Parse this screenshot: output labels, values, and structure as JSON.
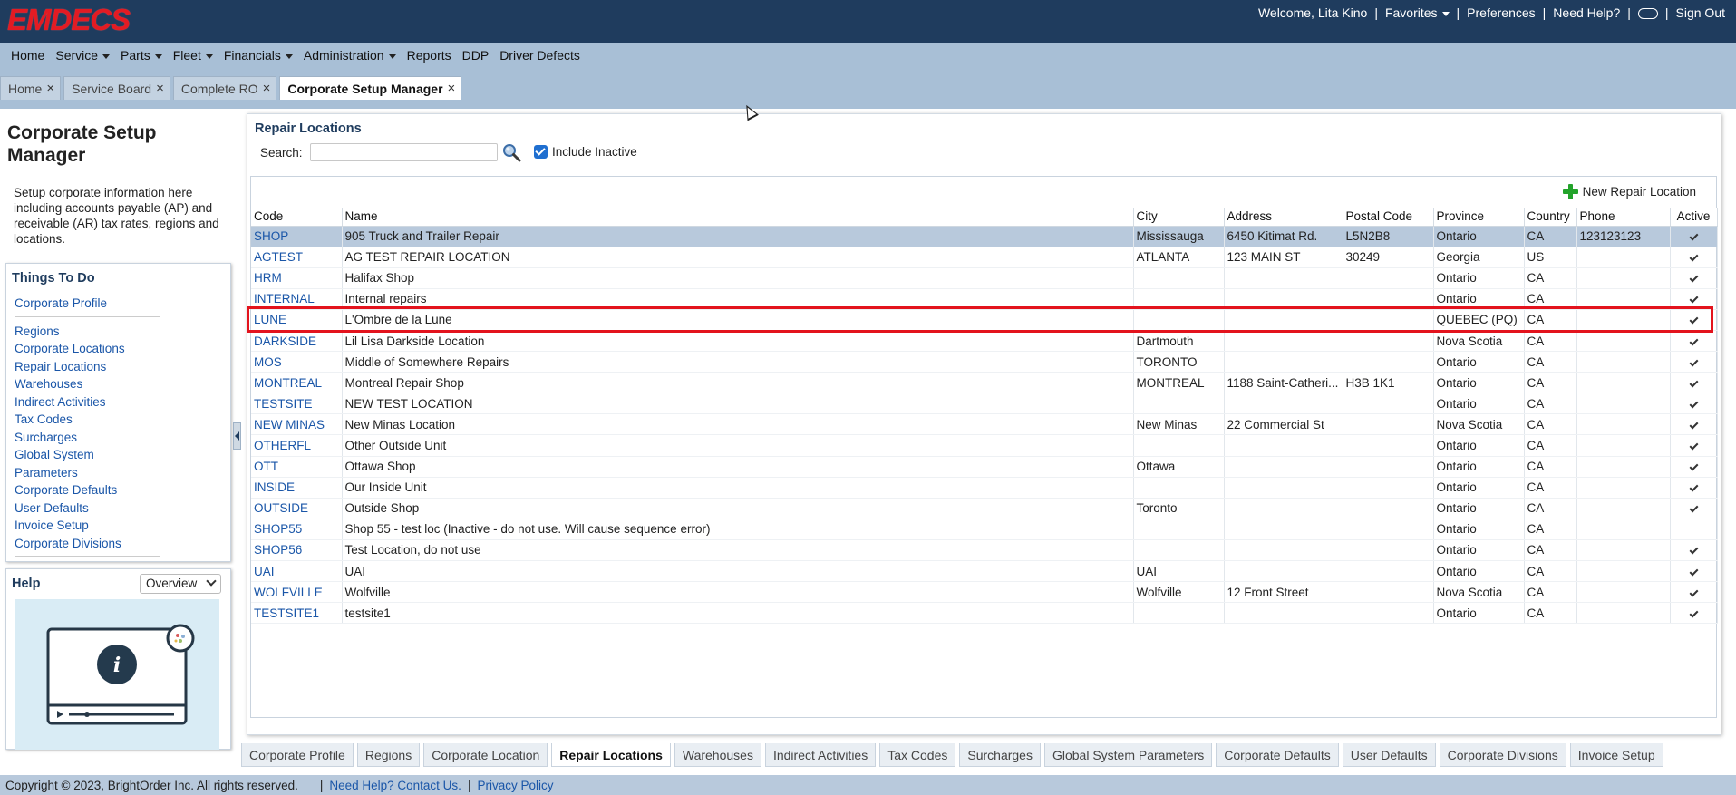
{
  "brand": {
    "logo_text": "EMDECS",
    "logo_color": "#e31b23"
  },
  "topnav": {
    "welcome": "Welcome, Lita Kino",
    "favorites": "Favorites",
    "preferences": "Preferences",
    "need_help": "Need Help?",
    "sign_out": "Sign Out",
    "chat_icon": "chat-bubble-icon",
    "separator": "|"
  },
  "mainmenu": {
    "home": "Home",
    "service": "Service",
    "parts": "Parts",
    "fleet": "Fleet",
    "financials": "Financials",
    "administration": "Administration",
    "reports": "Reports",
    "ddp": "DDP",
    "driver_defects": "Driver Defects"
  },
  "pagetabs": {
    "home": "Home",
    "service_board": "Service Board",
    "complete_ro": "Complete RO",
    "corporate_setup_manager": "Corporate Setup Manager",
    "close_glyph": "×"
  },
  "left": {
    "title": "Corporate Setup Manager",
    "description": "Setup corporate information here including accounts payable (AP) and receivable (AR) tax rates, regions and locations.",
    "todo_title": "Things To Do",
    "todo_first": "Corporate Profile",
    "todo_items": [
      "Regions",
      "Corporate Locations",
      "Repair Locations",
      "Warehouses",
      "Indirect Activities",
      "Tax Codes",
      "Surcharges",
      "Global System Parameters",
      "Corporate Defaults",
      "User Defaults",
      "Invoice Setup",
      "Corporate Divisions"
    ],
    "help_title": "Help",
    "help_select": "Overview"
  },
  "main": {
    "title": "Repair Locations",
    "search_label": "Search:",
    "search_value": "",
    "include_inactive_label": "Include Inactive",
    "include_inactive_checked": true,
    "new_button": "New Repair Location",
    "columns": {
      "code": "Code",
      "name": "Name",
      "city": "City",
      "address": "Address",
      "postal": "Postal Code",
      "province": "Province",
      "country": "Country",
      "phone": "Phone",
      "active": "Active"
    },
    "rows": [
      {
        "code": "SHOP",
        "name": "905 Truck and Trailer Repair",
        "city": "Mississauga",
        "address": "6450 Kitimat Rd.",
        "postal": "L5N2B8",
        "province": "Ontario",
        "country": "CA",
        "phone": "123123123",
        "active": true
      },
      {
        "code": "AGTEST",
        "name": "AG TEST REPAIR LOCATION",
        "city": "ATLANTA",
        "address": "123 MAIN ST",
        "postal": "30249",
        "province": "Georgia",
        "country": "US",
        "phone": "",
        "active": true
      },
      {
        "code": "HRM",
        "name": "Halifax Shop",
        "city": "",
        "address": "",
        "postal": "",
        "province": "Ontario",
        "country": "CA",
        "phone": "",
        "active": true
      },
      {
        "code": "INTERNAL",
        "name": "Internal repairs",
        "city": "",
        "address": "",
        "postal": "",
        "province": "Ontario",
        "country": "CA",
        "phone": "",
        "active": true
      },
      {
        "code": "LUNE",
        "name": "L'Ombre de la Lune",
        "city": "",
        "address": "",
        "postal": "",
        "province": "QUEBEC (PQ)",
        "country": "CA",
        "phone": "",
        "active": true
      },
      {
        "code": "DARKSIDE",
        "name": "Lil Lisa Darkside Location",
        "city": "Dartmouth",
        "address": "",
        "postal": "",
        "province": "Nova Scotia",
        "country": "CA",
        "phone": "",
        "active": true
      },
      {
        "code": "MOS",
        "name": "Middle of Somewhere Repairs",
        "city": "TORONTO",
        "address": "",
        "postal": "",
        "province": "Ontario",
        "country": "CA",
        "phone": "",
        "active": true
      },
      {
        "code": "MONTREAL",
        "name": "Montreal Repair Shop",
        "city": "MONTREAL",
        "address": "1188 Saint-Catheri...",
        "postal": "H3B 1K1",
        "province": "Ontario",
        "country": "CA",
        "phone": "",
        "active": true
      },
      {
        "code": "TESTSITE",
        "name": "NEW TEST LOCATION",
        "city": "",
        "address": "",
        "postal": "",
        "province": "Ontario",
        "country": "CA",
        "phone": "",
        "active": true
      },
      {
        "code": "NEW MINAS",
        "name": "New Minas Location",
        "city": "New Minas",
        "address": "22 Commercial St",
        "postal": "",
        "province": "Nova Scotia",
        "country": "CA",
        "phone": "",
        "active": true
      },
      {
        "code": "OTHERFL",
        "name": "Other Outside Unit",
        "city": "",
        "address": "",
        "postal": "",
        "province": "Ontario",
        "country": "CA",
        "phone": "",
        "active": true
      },
      {
        "code": "OTT",
        "name": "Ottawa Shop",
        "city": "Ottawa",
        "address": "",
        "postal": "",
        "province": "Ontario",
        "country": "CA",
        "phone": "",
        "active": true
      },
      {
        "code": "INSIDE",
        "name": "Our Inside Unit",
        "city": "",
        "address": "",
        "postal": "",
        "province": "Ontario",
        "country": "CA",
        "phone": "",
        "active": true
      },
      {
        "code": "OUTSIDE",
        "name": "Outside Shop",
        "city": "Toronto",
        "address": "",
        "postal": "",
        "province": "Ontario",
        "country": "CA",
        "phone": "",
        "active": true
      },
      {
        "code": "SHOP55",
        "name": "Shop 55 - test loc (Inactive - do not use. Will cause sequence error)",
        "city": "",
        "address": "",
        "postal": "",
        "province": "Ontario",
        "country": "CA",
        "phone": "",
        "active": false
      },
      {
        "code": "SHOP56",
        "name": "Test Location, do not use",
        "city": "",
        "address": "",
        "postal": "",
        "province": "Ontario",
        "country": "CA",
        "phone": "",
        "active": true
      },
      {
        "code": "UAI",
        "name": "UAI",
        "city": "UAI",
        "address": "",
        "postal": "",
        "province": "Ontario",
        "country": "CA",
        "phone": "",
        "active": true
      },
      {
        "code": "WOLFVILLE",
        "name": "Wolfville",
        "city": "Wolfville",
        "address": "12 Front Street",
        "postal": "",
        "province": "Nova Scotia",
        "country": "CA",
        "phone": "",
        "active": true
      },
      {
        "code": "TESTSITE1",
        "name": "testsite1",
        "city": "",
        "address": "",
        "postal": "",
        "province": "Ontario",
        "country": "CA",
        "phone": "",
        "active": true
      }
    ]
  },
  "bottom_tabs": [
    "Corporate Profile",
    "Regions",
    "Corporate Location",
    "Repair Locations",
    "Warehouses",
    "Indirect Activities",
    "Tax Codes",
    "Surcharges",
    "Global System Parameters",
    "Corporate Defaults",
    "User Defaults",
    "Corporate Divisions",
    "Invoice Setup"
  ],
  "bottom_active": "Repair Locations",
  "footer": {
    "copyright": "Copyright © 2023, BrightOrder Inc. All rights reserved.",
    "need_help": "Need Help? Contact Us.",
    "privacy": "Privacy Policy",
    "separator": "|"
  }
}
